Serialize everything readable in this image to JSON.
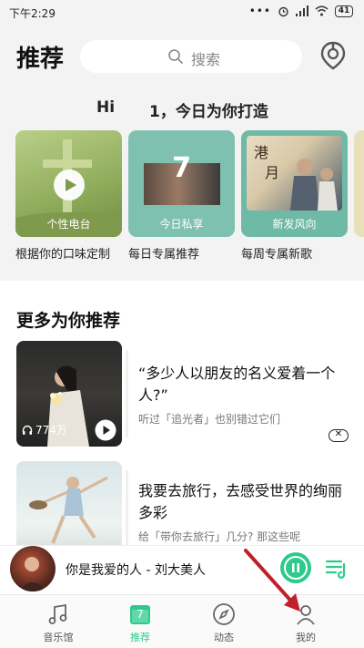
{
  "status_bar": {
    "time": "下午2:29",
    "battery": "41"
  },
  "header": {
    "title": "推荐",
    "search_placeholder": "搜索"
  },
  "greeting": {
    "hi": "Hi",
    "message": "1，今日为你打造"
  },
  "cards": [
    {
      "label": "个性电台",
      "caption": "根据你的口味定制"
    },
    {
      "label": "今日私享",
      "number": "7",
      "caption": "每日专属推荐"
    },
    {
      "label": "新发风向",
      "caption": "每周专属新歌"
    }
  ],
  "section": {
    "title": "更多为你推荐"
  },
  "recommendations": [
    {
      "title": "“多少人以朋友的名义爱着一个人?”",
      "subtitle": "听过「追光者」也别错过它们",
      "play_count": "774万"
    },
    {
      "title": "我要去旅行，去感受世界的绚丽多彩",
      "subtitle": "给「带你去旅行」几分? 那这些呢"
    }
  ],
  "now_playing": {
    "song": "你是我爱的人 - 刘大美人"
  },
  "tabs": [
    {
      "label": "音乐馆",
      "icon": "music-note-icon"
    },
    {
      "label": "推荐",
      "icon": "calendar-icon",
      "badge": "7",
      "active": true
    },
    {
      "label": "动态",
      "icon": "compass-icon"
    },
    {
      "label": "我的",
      "icon": "user-icon"
    }
  ],
  "colors": {
    "accent": "#2dcb8b",
    "annotation_arrow": "#c0202a"
  }
}
